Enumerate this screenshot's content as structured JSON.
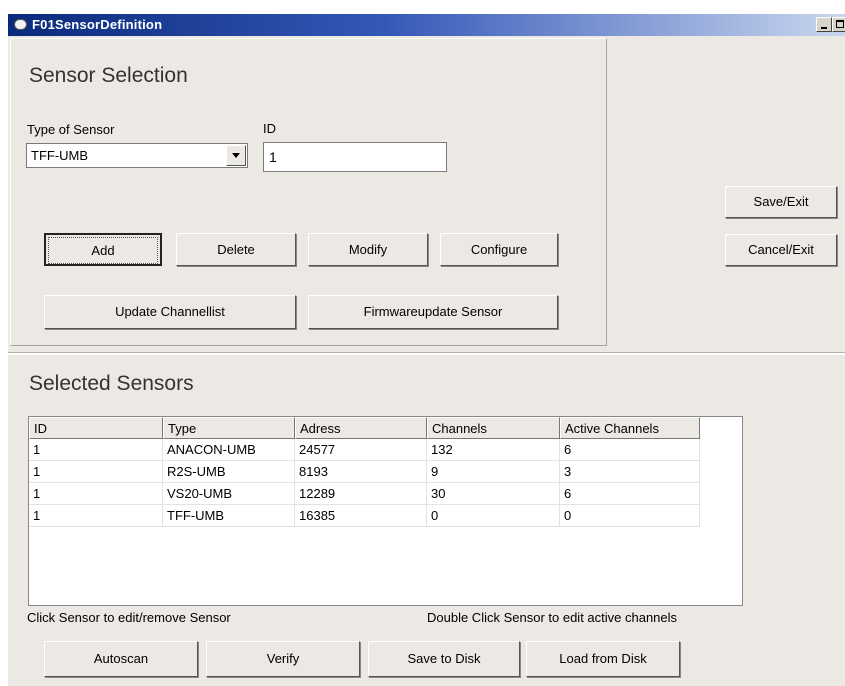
{
  "window": {
    "title": "F01SensorDefinition"
  },
  "sensor_selection": {
    "title": "Sensor Selection",
    "type_label": "Type of Sensor",
    "type_value": "TFF-UMB",
    "id_label": "ID",
    "id_value": "1"
  },
  "buttons": {
    "add": "Add",
    "delete": "Delete",
    "modify": "Modify",
    "configure": "Configure",
    "update_channellist": "Update Channellist",
    "firmware_update": "Firmwareupdate Sensor",
    "save_exit": "Save/Exit",
    "cancel_exit": "Cancel/Exit",
    "autoscan": "Autoscan",
    "verify": "Verify",
    "save_to_disk": "Save to Disk",
    "load_from_disk": "Load from Disk"
  },
  "selected_sensors": {
    "title": "Selected Sensors",
    "columns": [
      "ID",
      "Type",
      "Adress",
      "Channels",
      "Active Channels"
    ],
    "rows": [
      [
        "1",
        "ANACON-UMB",
        "24577",
        "132",
        "6"
      ],
      [
        "1",
        "R2S-UMB",
        "8193",
        "9",
        "3"
      ],
      [
        "1",
        "VS20-UMB",
        "12289",
        "30",
        "6"
      ],
      [
        "1",
        "TFF-UMB",
        "16385",
        "0",
        "0"
      ]
    ],
    "hint_left": "Click Sensor to edit/remove Sensor",
    "hint_right": "Double Click Sensor to edit active channels"
  }
}
